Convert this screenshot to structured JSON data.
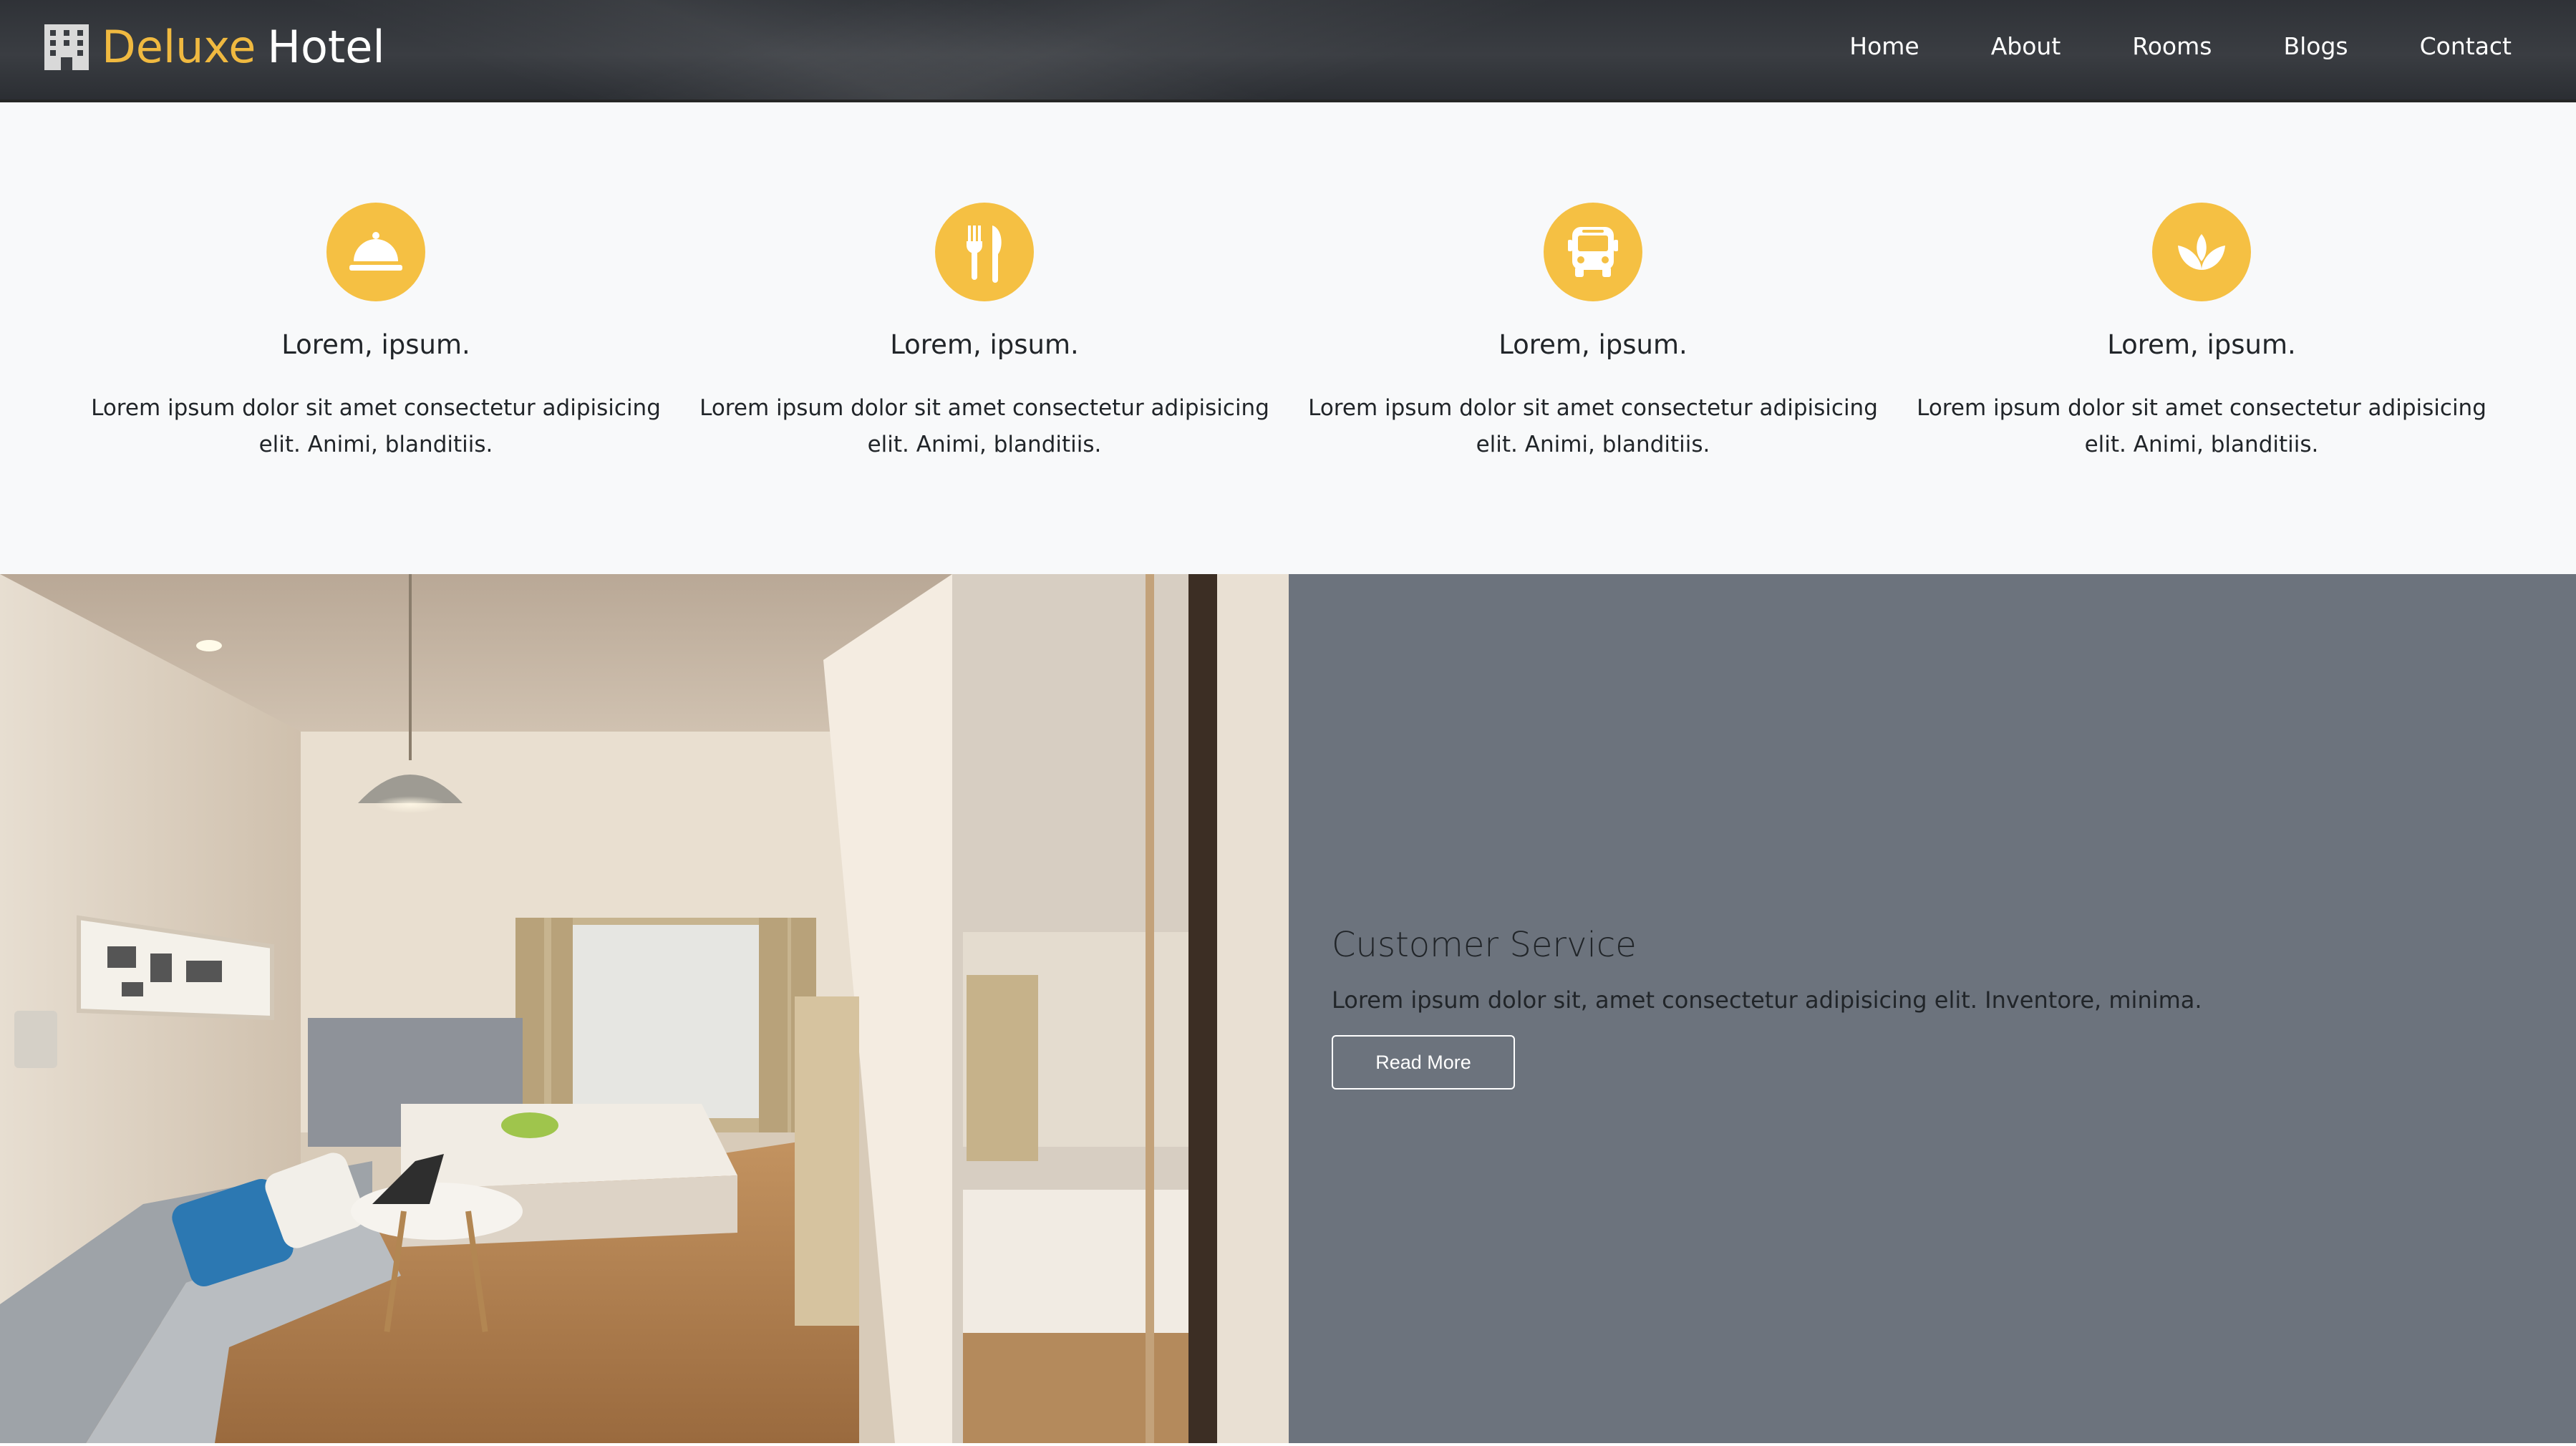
{
  "brand": {
    "name_part1": "Deluxe",
    "name_part2": "Hotel",
    "icon": "hotel-building-icon",
    "accent_color": "#f0b940"
  },
  "nav": {
    "items": [
      {
        "label": "Home"
      },
      {
        "label": "About"
      },
      {
        "label": "Rooms"
      },
      {
        "label": "Blogs"
      },
      {
        "label": "Contact"
      }
    ]
  },
  "features": {
    "icon_color": "#f5c043",
    "items": [
      {
        "icon": "concierge-bell-icon",
        "title": "Lorem, ipsum.",
        "text": "Lorem ipsum dolor sit amet consectetur adipisicing elit. Animi, blanditiis."
      },
      {
        "icon": "utensils-icon",
        "title": "Lorem, ipsum.",
        "text": "Lorem ipsum dolor sit amet consectetur adipisicing elit. Animi, blanditiis."
      },
      {
        "icon": "bus-icon",
        "title": "Lorem, ipsum.",
        "text": "Lorem ipsum dolor sit amet consectetur adipisicing elit. Animi, blanditiis."
      },
      {
        "icon": "spa-lotus-icon",
        "title": "Lorem, ipsum.",
        "text": "Lorem ipsum dolor sit amet consectetur adipisicing elit. Animi, blanditiis."
      }
    ]
  },
  "service": {
    "title": "Customer Service",
    "text": "Lorem ipsum dolor sit, amet consectetur adipisicing elit. Inventore, minima.",
    "button_label": "Read More",
    "panel_color": "#6c737d"
  }
}
